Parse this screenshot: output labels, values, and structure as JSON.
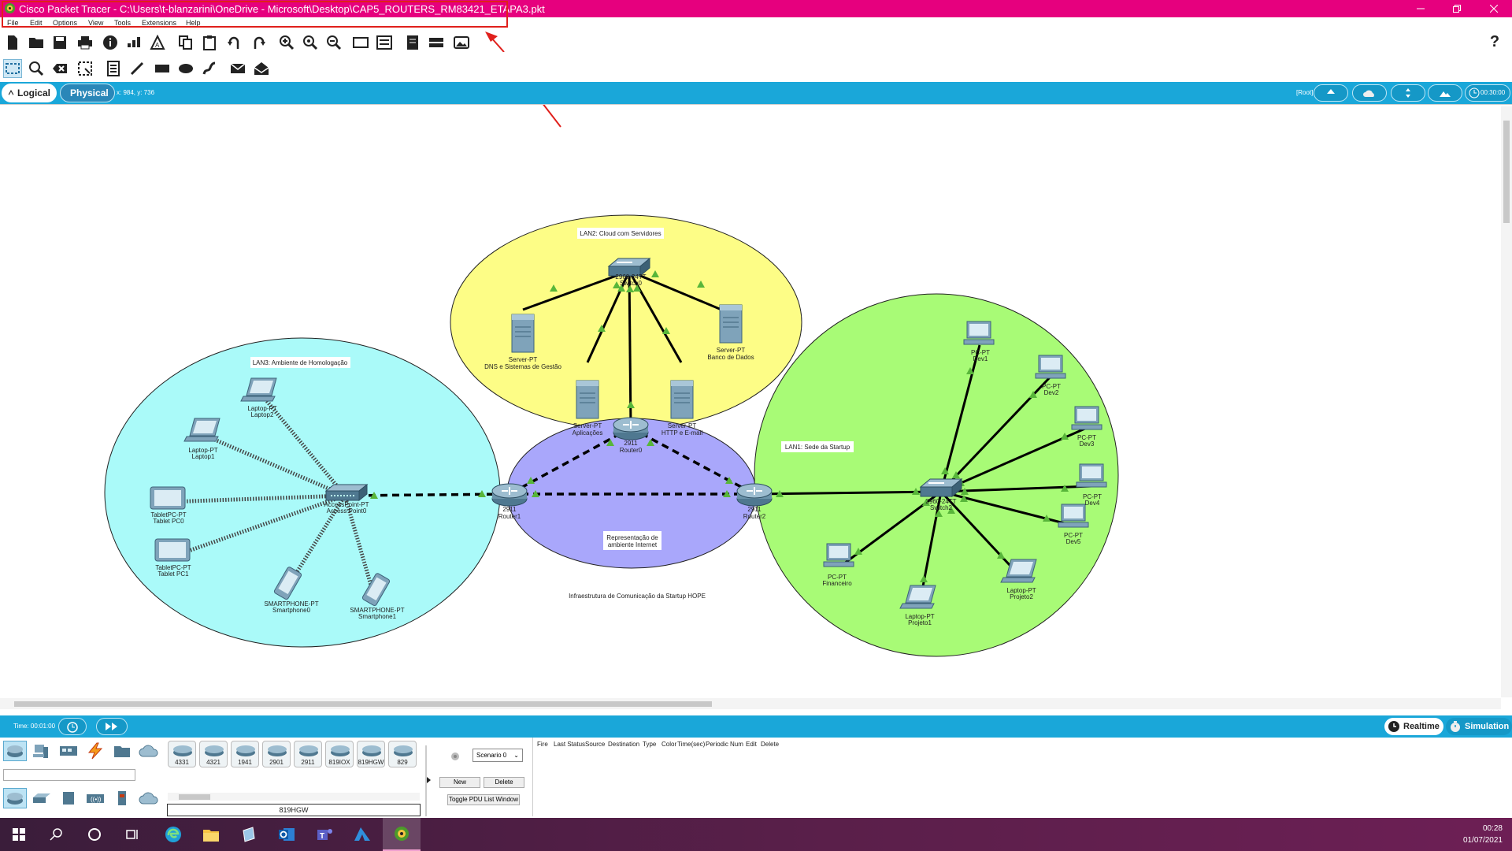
{
  "window": {
    "title": "Cisco Packet Tracer - C:\\Users\\t-blanzarini\\OneDrive - Microsoft\\Desktop\\CAP5_ROUTERS_RM83421_ETAPA3.pkt"
  },
  "menu": [
    "File",
    "Edit",
    "Options",
    "View",
    "Tools",
    "Extensions",
    "Help"
  ],
  "workspace_tabs": {
    "logical": "Logical",
    "physical": "Physical",
    "coords": "x: 984, y: 736",
    "root": "[Root]",
    "clock": "00:30:00"
  },
  "topology": {
    "caption": "Infraestrutura de Comunicação da Startup HOPE",
    "zones": {
      "lan2": "LAN2: Cloud com Servidores",
      "lan3": "LAN3: Ambiente de Homologação",
      "lan1": "LAN1: Sede da Startup",
      "internet_1": "Representação de",
      "internet_2": "ambiente Internet"
    },
    "devices": {
      "switch0": {
        "type": "2960-24TT",
        "name": "Switch0"
      },
      "srv_dns": {
        "type": "Server-PT",
        "name": "DNS e Sistemas de Gestão"
      },
      "srv_db": {
        "type": "Server-PT",
        "name": "Banco de Dados"
      },
      "srv_app": {
        "type": "Server-PT",
        "name": "Aplicações"
      },
      "srv_http": {
        "type": "Server-PT",
        "name": "HTTP e E-mail"
      },
      "router0": {
        "type": "2911",
        "name": "Router0"
      },
      "router1": {
        "type": "2911",
        "name": "Router1"
      },
      "router2": {
        "type": "2911",
        "name": "Router2"
      },
      "ap0": {
        "type": "AccessPoint-PT",
        "name": "Access Point0"
      },
      "laptop2": {
        "type": "Laptop-PT",
        "name": "Laptop2"
      },
      "laptop1": {
        "type": "Laptop-PT",
        "name": "Laptop1"
      },
      "tablet0": {
        "type": "TabletPC-PT",
        "name": "Tablet PC0"
      },
      "tablet1": {
        "type": "TabletPC-PT",
        "name": "Tablet PC1"
      },
      "phone0": {
        "type": "SMARTPHONE-PT",
        "name": "Smartphone0"
      },
      "phone1": {
        "type": "SMARTPHONE-PT",
        "name": "Smartphone1"
      },
      "switch2": {
        "type": "2960-24TT",
        "name": "Switch2"
      },
      "dev1": {
        "type": "PC-PT",
        "name": "Dev1"
      },
      "dev2": {
        "type": "PC-PT",
        "name": "Dev2"
      },
      "dev3": {
        "type": "PC-PT",
        "name": "Dev3"
      },
      "dev4": {
        "type": "PC-PT",
        "name": "Dev4"
      },
      "dev5": {
        "type": "PC-PT",
        "name": "Dev5"
      },
      "financeiro": {
        "type": "PC-PT",
        "name": "Financeiro"
      },
      "projeto1": {
        "type": "Laptop-PT",
        "name": "Projeto1"
      },
      "projeto2": {
        "type": "Laptop-PT",
        "name": "Projeto2"
      }
    }
  },
  "timebar": {
    "time": "Time: 00:01:00",
    "realtime": "Realtime",
    "simulation": "Simulation"
  },
  "device_panel": {
    "models": [
      "4331",
      "4321",
      "1941",
      "2901",
      "2911",
      "819IOX",
      "819HGW",
      "829"
    ],
    "selected_model": "819HGW"
  },
  "scenario": {
    "selected": "Scenario 0",
    "new": "New",
    "delete": "Delete",
    "toggle": "Toggle PDU List Window"
  },
  "pdu_columns": [
    "Fire",
    "Last Status",
    "Source",
    "Destination",
    "Type",
    "Color",
    "Time(sec)",
    "Periodic",
    "Num",
    "Edit",
    "Delete"
  ],
  "taskbar": {
    "time": "00:28",
    "date": "01/07/2021"
  }
}
